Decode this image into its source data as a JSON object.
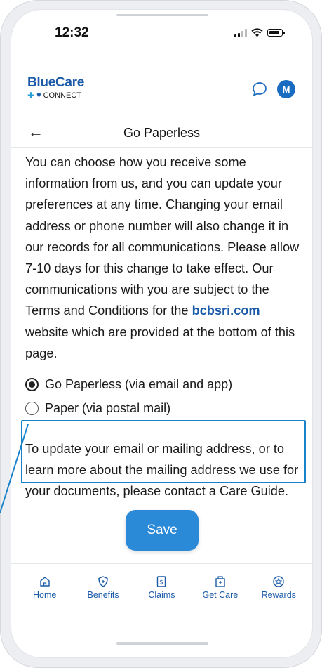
{
  "status_bar": {
    "time": "12:32"
  },
  "header": {
    "brand_name": "BlueCare",
    "brand_sub": "CONNECT",
    "avatar_initial": "M",
    "icons": [
      "chat-bubble-icon",
      "avatar"
    ]
  },
  "title_bar": {
    "back_label": "←",
    "title": "Go Paperless"
  },
  "intro": {
    "text_before_link": "You can choose how you receive some information from us, and you can update your preferences at any time. Changing your email address or phone number will also change it in our records for all communications. Please allow 7-10 days for this change to take effect. Our communications with you are subject to the Terms and Conditions for the ",
    "link_text": "bcbsri.com",
    "text_after_link": " website which are provided at the bottom of this page."
  },
  "options": [
    {
      "label": "Go Paperless (via email and app)",
      "selected": true
    },
    {
      "label": "Paper (via postal mail)",
      "selected": false
    }
  ],
  "footer_text": "To update your email or mailing address, or to learn more about the mailing address we use for your documents, please contact a Care Guide.",
  "save_button": {
    "label": "Save"
  },
  "tabs": [
    {
      "label": "Home",
      "icon": "home-icon"
    },
    {
      "label": "Benefits",
      "icon": "shield-icon"
    },
    {
      "label": "Claims",
      "icon": "dollar-receipt-icon"
    },
    {
      "label": "Get Care",
      "icon": "hospital-icon"
    },
    {
      "label": "Rewards",
      "icon": "rewards-star-icon"
    }
  ],
  "colors": {
    "brand": "#1a5aa8",
    "accent": "#2b8ad8",
    "callout": "#1a82c9"
  }
}
